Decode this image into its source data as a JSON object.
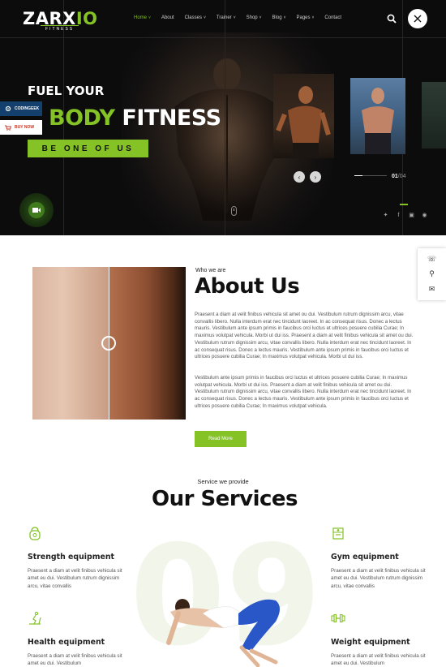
{
  "brand": {
    "name_start": "ZARX",
    "name_accent": "IO",
    "tagline": "FITNESS",
    "accent_color": "#84c225"
  },
  "nav": {
    "items": [
      {
        "label": "Home",
        "dropdown": true,
        "active": true
      },
      {
        "label": "About",
        "dropdown": false
      },
      {
        "label": "Classes",
        "dropdown": true
      },
      {
        "label": "Trainer",
        "dropdown": true
      },
      {
        "label": "Shop",
        "dropdown": true
      },
      {
        "label": "Blog",
        "dropdown": true
      },
      {
        "label": "Pages",
        "dropdown": true
      },
      {
        "label": "Contact",
        "dropdown": false
      }
    ],
    "search_icon": "search-icon",
    "close_icon": "close-icon"
  },
  "hero": {
    "line1": "FUEL YOUR",
    "line2_green": "BODY",
    "line2_white": " FITNESS",
    "cta": "BE ONE OF US",
    "slide_current": "01",
    "slide_total": "/04",
    "slide_progress": 0.25,
    "prev_icon": "chevron-left-icon",
    "next_icon": "chevron-right-icon",
    "social_icons": [
      "twitter-icon",
      "facebook-icon",
      "instagram-icon",
      "pinterest-icon"
    ]
  },
  "floating": {
    "codingeek": "CODINGEEK",
    "buy_now": "BUY NOW"
  },
  "side_tools": [
    "phone-icon",
    "location-icon",
    "mail-icon"
  ],
  "about": {
    "eyebrow": "Who we are",
    "title": "About Us",
    "p1": "Praesent a diam at velit finibus vehicula sit amet ou dui. Vestibulum rutrum dignissim arcu, vitae convallis libero. Nulla interdum erat nec tincidunt laoreet. In ac consequat risus. Donec a lectus mauris. Vestibulum ante ipsum primis in faucibus orci luctus et ultrices posuere cubilia Curae; In maximus volutpat vehicula. Morbi ut dui iss. Praesent a diam at velit finibus vehicula sit amet ou dui. Vestibulum rutrum dignissim arcu, vitae convallis libero. Nulla interdum erat nec tincidunt laoreet. In ac consequat risus. Donec a lectus mauris. Vestibulum ante ipsum primis in faucibus orci luctus et ultrices posuere cubilia Curae; In maximus volutpat vehicula. Morbi ut dui iss.",
    "p2": "Vestibulum ante ipsum primis in faucibus orci luctus et ultrices posuere cubilia Curae; In maximus volutpat vehicula. Morbi ut dui iss. Praesent a diam at velit finibus vehicula sit amet ou dui. Vestibulum rutrum dignissim arcu, vitae convallis libero. Nulla interdum erat nec tincidunt laoreet. In ac consequat risus. Donec a lectus mauris. Vestibulum ante ipsum primis in faucibus orci luctus et ultrices posuere cubilia Curae; In maximus volutpat vehicula.",
    "button": "Read More"
  },
  "services": {
    "eyebrow": "Service we provide",
    "title": "Our Services",
    "bg_digits": "09",
    "items": [
      {
        "name": "Strength equipment",
        "icon": "kettlebell-icon",
        "desc": "Praesent a diam at velit finibus vehicula sit amet eu dui. Vestibulum rutrum dignissim arcu, vitae convallis"
      },
      {
        "name": "Gym equipment",
        "icon": "gym-machine-icon",
        "desc": "Praesent a diam at velit finibus vehicula sit amet eu dui. Vestibulum rutrum dignissim arcu, vitae convallis"
      },
      {
        "name": "Health equipment",
        "icon": "treadmill-icon",
        "desc": "Praesent a diam at velit finibus vehicula sit amet eu dui. Vestibulum"
      },
      {
        "name": "Weight equipment",
        "icon": "dumbbell-icon",
        "desc": "Praesent a diam at velit finibus vehicula sit amet eu dui. Vestibulum"
      }
    ]
  }
}
